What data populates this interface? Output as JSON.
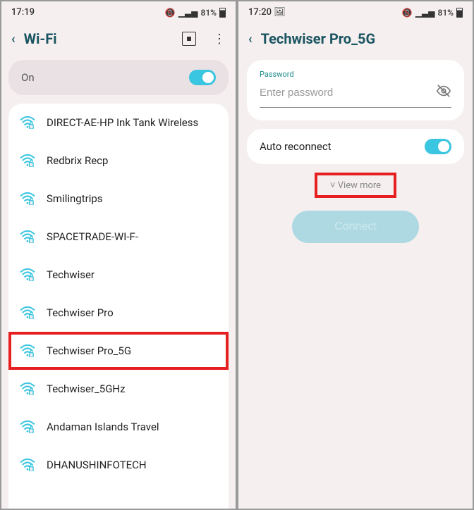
{
  "left": {
    "status": {
      "time": "17:19",
      "battery": "81%"
    },
    "header": {
      "title": "Wi-Fi"
    },
    "toggle": {
      "label": "On"
    },
    "networks": [
      "DIRECT-AE-HP Ink Tank Wireless",
      "Redbrix Recp",
      "Smilingtrips",
      "SPACETRADE-WI-F-",
      "Techwiser",
      "Techwiser Pro",
      "Techwiser Pro_5G",
      "Techwiser_5GHz",
      "Andaman Islands Travel",
      "DHANUSHINFOTECH"
    ],
    "highlight_index": 6
  },
  "right": {
    "status": {
      "time": "17:20",
      "battery": "81%"
    },
    "header": {
      "title": "Techwiser Pro_5G"
    },
    "password": {
      "label": "Password",
      "placeholder": "Enter password"
    },
    "auto_reconnect": "Auto reconnect",
    "view_more": "View more",
    "connect": "Connect"
  }
}
